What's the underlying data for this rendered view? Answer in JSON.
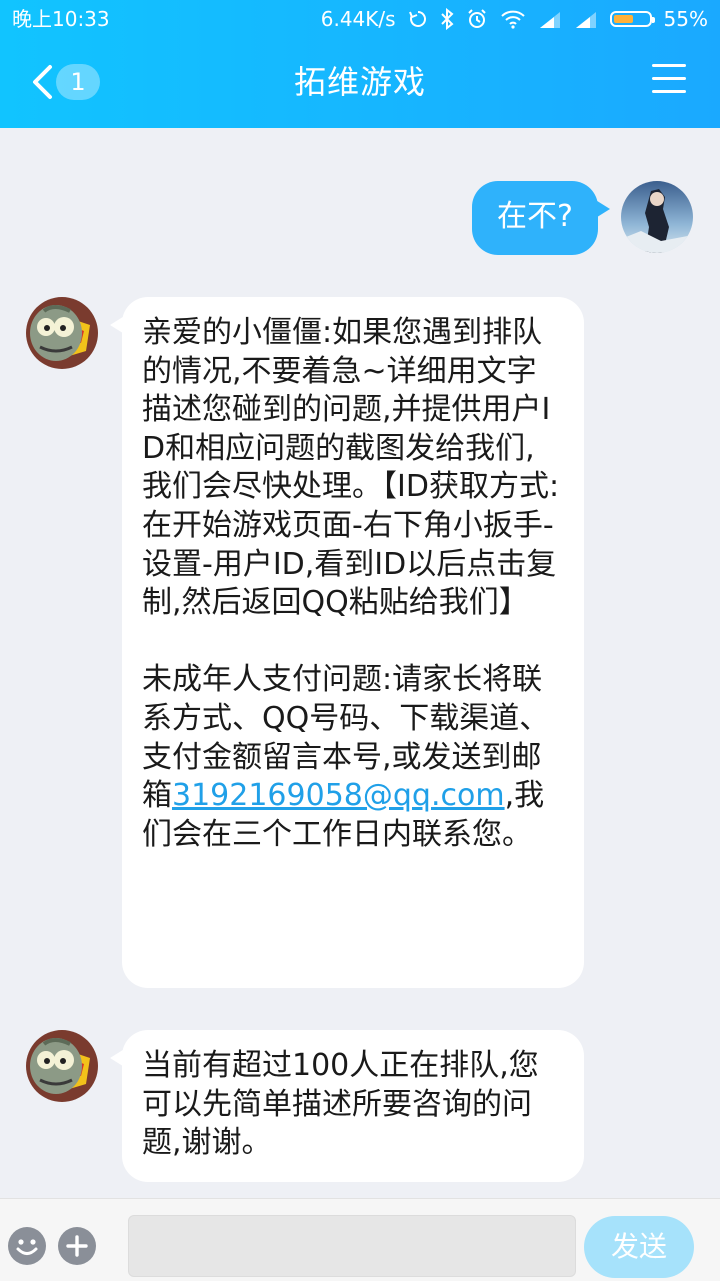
{
  "status_bar": {
    "time": "晚上10:33",
    "network_speed": "6.44K/s",
    "battery_percent": "55%",
    "battery_level": 0.55
  },
  "header": {
    "back_badge": "1",
    "title": "拓维游戏"
  },
  "messages": [
    {
      "side": "right",
      "text": "在不?"
    },
    {
      "side": "left",
      "paragraphs": [
        "亲爱的小僵僵:如果您遇到排队的情况,不要着急~详细用文字描述您碰到的问题,并提供用户ID和相应问题的截图发给我们,我们会尽快处理。【ID获取方式:在开始游戏页面-右下角小扳手-设置-用户ID,看到ID以后点击复制,然后返回QQ粘贴给我们】",
        "未成年人支付问题:请家长将联系方式、QQ号码、下载渠道、支付金额留言本号,或发送到邮箱"
      ],
      "email": "3192169058@qq.com",
      "after_email": ",我们会在三个工作日内联系您。"
    },
    {
      "side": "left",
      "text": "当前有超过100人正在排队,您可以先简单描述所要咨询的问题,谢谢。"
    }
  ],
  "input_bar": {
    "placeholder": "",
    "send_label": "发送"
  },
  "colors": {
    "header_gradient_start": "#11c4ff",
    "header_gradient_end": "#1aa9ff",
    "my_bubble": "#2fb2fb",
    "link": "#20a0e8",
    "send_button": "#a6e2fb"
  }
}
